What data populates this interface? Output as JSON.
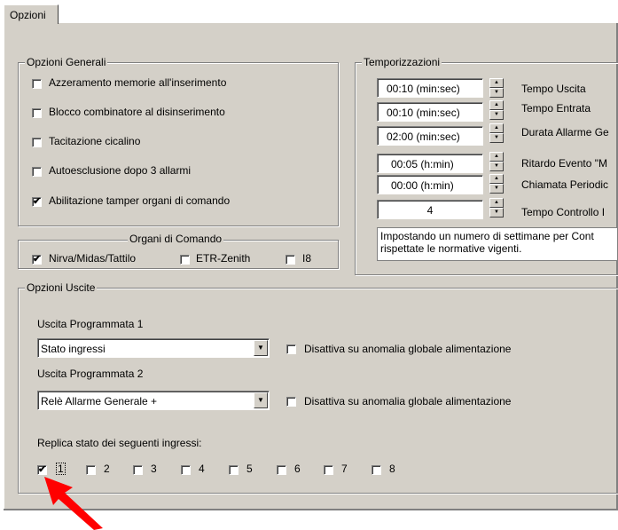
{
  "tab": {
    "label": "Opzioni"
  },
  "general": {
    "legend": "Opzioni Generali",
    "items": [
      {
        "label": "Azzeramento memorie all'inserimento",
        "checked": false
      },
      {
        "label": "Blocco combinatore al disinserimento",
        "checked": false
      },
      {
        "label": "Tacitazione cicalino",
        "checked": false
      },
      {
        "label": "Autoesclusione dopo 3 allarmi",
        "checked": false
      },
      {
        "label": "Abilitazione tamper organi di comando",
        "checked": true
      }
    ]
  },
  "organs": {
    "legend": "Organi di Comando",
    "items": [
      {
        "label": "Nirva/Midas/Tattilo",
        "checked": true
      },
      {
        "label": "ETR-Zenith",
        "checked": false
      },
      {
        "label": "I8",
        "checked": false
      }
    ]
  },
  "timings": {
    "legend": "Temporizzazioni",
    "rows": [
      {
        "value": "00:10  (min:sec)",
        "label": "Tempo Uscita"
      },
      {
        "value": "00:10  (min:sec)",
        "label": "Tempo Entrata"
      },
      {
        "value": "02:00  (min:sec)",
        "label": "Durata Allarme Ge"
      },
      {
        "value": "00:05  (h:min)",
        "label": "Ritardo Evento \"M"
      },
      {
        "value": "00:00  (h:min)",
        "label": "Chiamata Periodic"
      },
      {
        "value": "4",
        "label": "Tempo Controllo I"
      }
    ],
    "note_line1": "Impostando un numero di settimane per Cont",
    "note_line2": "rispettate le normative vigenti."
  },
  "outputs": {
    "legend": "Opzioni Uscite",
    "out1": {
      "title": "Uscita Programmata 1",
      "value": "Stato ingressi",
      "option": "Disattiva su anomalia globale alimentazione",
      "option_checked": false
    },
    "out2": {
      "title": "Uscita Programmata 2",
      "value": "Relè Allarme Generale +",
      "option": "Disattiva su anomalia globale alimentazione",
      "option_checked": false
    },
    "replica_label": "Replica stato dei seguenti ingressi:",
    "inputs": [
      {
        "label": "1",
        "checked": true
      },
      {
        "label": "2",
        "checked": false
      },
      {
        "label": "3",
        "checked": false
      },
      {
        "label": "4",
        "checked": false
      },
      {
        "label": "5",
        "checked": false
      },
      {
        "label": "6",
        "checked": false
      },
      {
        "label": "7",
        "checked": false
      },
      {
        "label": "8",
        "checked": false
      }
    ]
  },
  "colors": {
    "face": "#d4d0c8",
    "arrow": "#ff0000"
  },
  "icons": {
    "check": "✔",
    "spin_up": "▲",
    "spin_down": "▼",
    "combo": "▼"
  }
}
